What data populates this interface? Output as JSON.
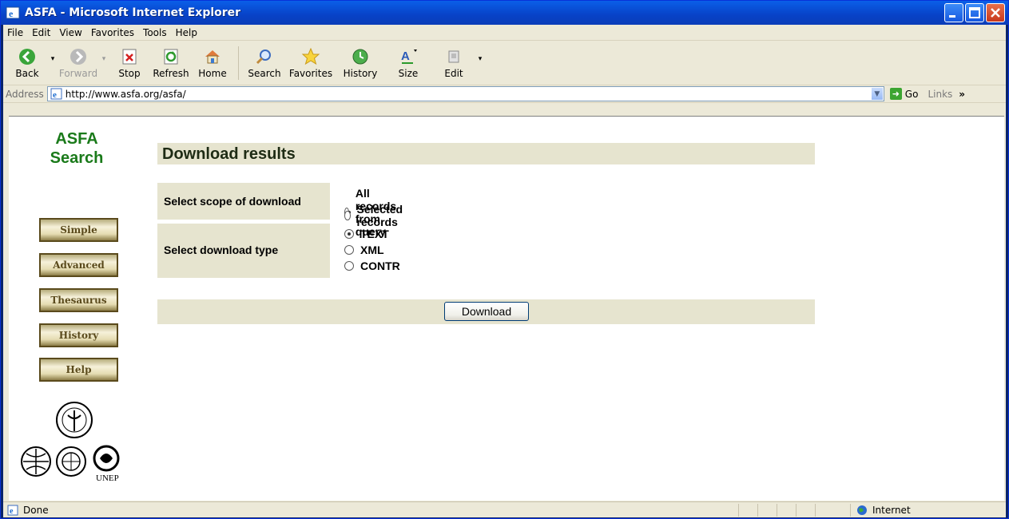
{
  "window": {
    "title": "ASFA - Microsoft Internet Explorer"
  },
  "menu": [
    "File",
    "Edit",
    "View",
    "Favorites",
    "Tools",
    "Help"
  ],
  "toolbar": {
    "back": "Back",
    "forward": "Forward",
    "stop": "Stop",
    "refresh": "Refresh",
    "home": "Home",
    "search": "Search",
    "favorites": "Favorites",
    "history": "History",
    "size": "Size",
    "edit": "Edit"
  },
  "address": {
    "label": "Address",
    "url": "http://www.asfa.org/asfa/",
    "go": "Go",
    "links": "Links"
  },
  "sidebar": {
    "brand_line1": "ASFA",
    "brand_line2": "Search",
    "buttons": [
      "Simple",
      "Advanced",
      "Thesaurus",
      "History",
      "Help"
    ],
    "logo_text": "UNEP"
  },
  "main": {
    "heading": "Download results",
    "scope": {
      "label": "Select scope of download",
      "options": [
        "All records from query",
        "Selected records"
      ],
      "selected": 0
    },
    "type": {
      "label": "Select download type",
      "options": [
        "TEXT",
        "XML",
        "CONTR"
      ],
      "selected": 0
    },
    "download_button": "Download"
  },
  "status": {
    "text": "Done",
    "zone": "Internet"
  },
  "colors": {
    "brand_green": "#1a7a1a",
    "panel_bg": "#e6e4cf",
    "titlebar_blue": "#0842c7"
  }
}
